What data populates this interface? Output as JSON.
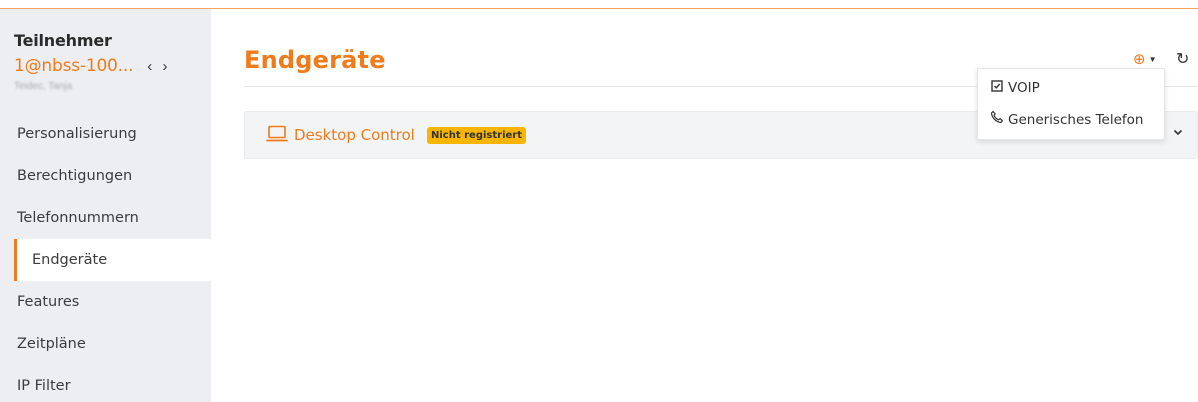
{
  "sidebar": {
    "title": "Teilnehmer",
    "user_id": "1@nbss-100...",
    "nav_arrows": "‹ ›",
    "user_name_blurred": "Teidec, Tanja",
    "items": [
      {
        "label": "Personalisierung",
        "active": false
      },
      {
        "label": "Berechtigungen",
        "active": false
      },
      {
        "label": "Telefonnummern",
        "active": false
      },
      {
        "label": "Endgeräte",
        "active": true
      },
      {
        "label": "Features",
        "active": false
      },
      {
        "label": "Zeitpläne",
        "active": false
      },
      {
        "label": "IP Filter",
        "active": false
      }
    ]
  },
  "main": {
    "title": "Endgeräte",
    "add_icon": "⊕",
    "refresh_icon": "↻",
    "devices": [
      {
        "name": "Desktop Control",
        "status": "Nicht registriert"
      }
    ],
    "dropdown": [
      {
        "icon": "checkbox-icon",
        "label": "VOIP"
      },
      {
        "icon": "phone-icon",
        "label": "Generisches Telefon"
      }
    ]
  },
  "colors": {
    "accent": "#f07b1a",
    "badge": "#f7b500",
    "sidebar_bg": "#eceef1"
  }
}
